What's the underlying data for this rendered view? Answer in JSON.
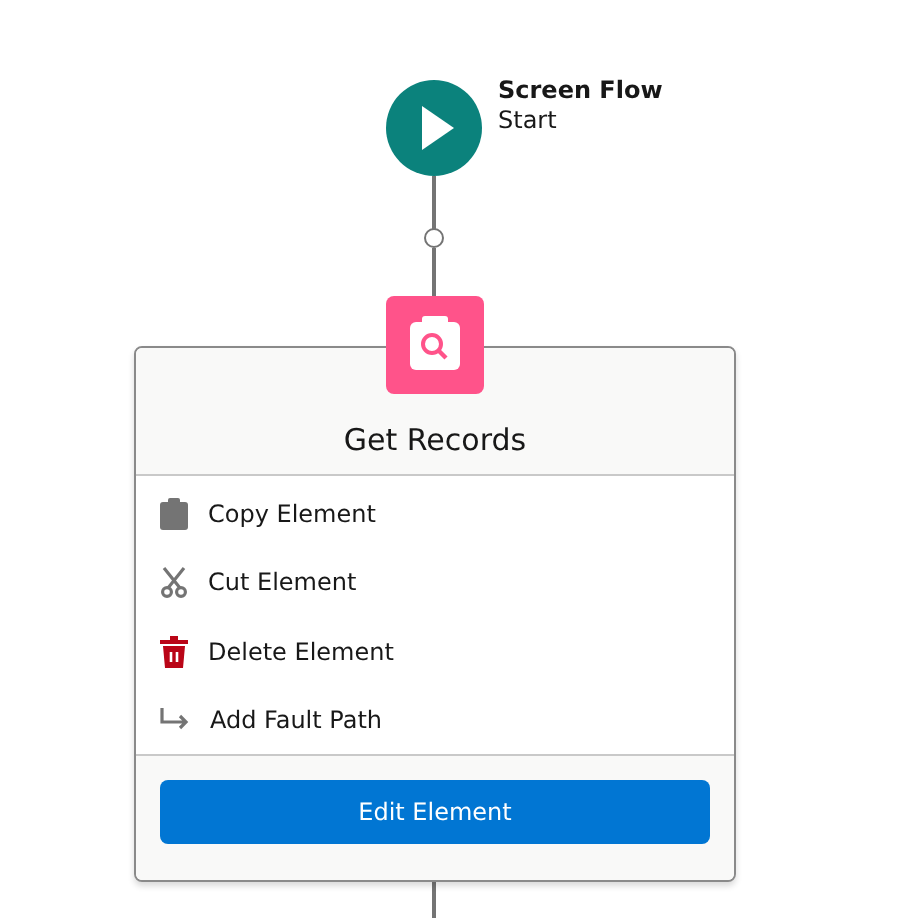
{
  "start_node": {
    "title": "Screen Flow",
    "subtitle": "Start"
  },
  "element_menu": {
    "title": "Get Records",
    "items": [
      {
        "kind": "copy",
        "label": "Copy Element"
      },
      {
        "kind": "cut",
        "label": "Cut Element"
      },
      {
        "kind": "delete",
        "label": "Delete Element"
      },
      {
        "kind": "fault",
        "label": "Add Fault Path"
      }
    ],
    "button": "Edit Element"
  }
}
